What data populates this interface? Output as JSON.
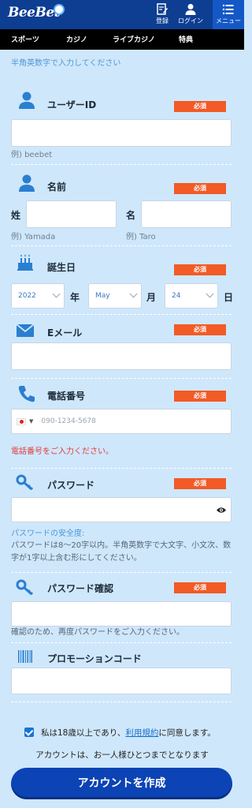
{
  "header": {
    "logo": "BeeBet",
    "register_label": "登録",
    "login_label": "ログイン",
    "menu_label": "メニュー"
  },
  "nav": {
    "items": [
      "スポーツ",
      "カジノ",
      "ライブカジノ",
      "特典"
    ]
  },
  "form": {
    "hint_top": "半角英数字で入力してください",
    "required_label": "必須",
    "username": {
      "title": "ユーザーID",
      "value": "",
      "example": "例) beebet"
    },
    "name": {
      "title": "名前",
      "last_label": "姓",
      "first_label": "名",
      "last_example": "例) Yamada",
      "first_example": "例) Taro"
    },
    "birthday": {
      "title": "誕生日",
      "year": "2022",
      "year_unit": "年",
      "month": "May",
      "month_unit": "月",
      "day": "24",
      "day_unit": "日"
    },
    "email": {
      "title": "Eメール",
      "value": ""
    },
    "phone": {
      "title": "電話番号",
      "placeholder": "090-1234-5678",
      "error": "電話番号をご入力ください。"
    },
    "password": {
      "title": "パスワード",
      "strength_label": "パスワードの安全度:",
      "note": "パスワードは8～20字以内。半角英数字で大文字、小文次、数字が1字以上含む形にしてください。"
    },
    "password_confirm": {
      "title": "パスワード確認",
      "note": "確認のため、再度パスワードをご入力ください。"
    },
    "promo": {
      "title": "プロモーションコード",
      "value": ""
    },
    "agree": {
      "prefix": "私は18歳以上であり、",
      "link": "利用規約",
      "suffix": "に同意します。",
      "checked": true
    },
    "one_account": "アカウントは、お一人様ひとつまでとなります",
    "submit_label": "アカウントを作成"
  },
  "colors": {
    "header_bg": "#0d3e92",
    "nav_bg": "#000000",
    "page_bg": "#cfe7fb",
    "required_badge": "#f25a26",
    "submit_bg": "#0c43b5",
    "error_text": "#e13b3b",
    "link": "#1a6fd1"
  }
}
